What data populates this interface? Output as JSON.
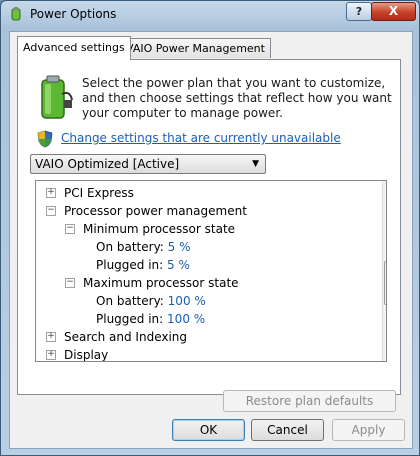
{
  "window": {
    "title": "Power Options"
  },
  "titlebar": {
    "help_label": "?",
    "close_label": "X"
  },
  "tabs": [
    {
      "label": "Advanced settings",
      "active": true
    },
    {
      "label": "VAIO Power Management",
      "active": false
    }
  ],
  "intro": {
    "text": "Select the power plan that you want to customize, and then choose settings that reflect how you want your computer to manage power.",
    "link": "Change settings that are currently unavailable"
  },
  "plan_select": {
    "value": "VAIO Optimized [Active]"
  },
  "tree": {
    "rows": [
      {
        "label": "PCI Express",
        "value": "",
        "expander": "+"
      },
      {
        "label": "Processor power management",
        "value": "",
        "expander": "−"
      },
      {
        "label": "Minimum processor state",
        "value": "",
        "expander": "−"
      },
      {
        "label": "On battery:",
        "value": "5 %",
        "expander": ""
      },
      {
        "label": "Plugged in:",
        "value": "5 %",
        "expander": ""
      },
      {
        "label": "Maximum processor state",
        "value": "",
        "expander": "−"
      },
      {
        "label": "On battery:",
        "value": "100 %",
        "expander": ""
      },
      {
        "label": "Plugged in:",
        "value": "100 %",
        "expander": ""
      },
      {
        "label": "Search and Indexing",
        "value": "",
        "expander": "+"
      },
      {
        "label": "Display",
        "value": "",
        "expander": "+"
      }
    ]
  },
  "buttons": {
    "restore": "Restore plan defaults",
    "ok": "OK",
    "cancel": "Cancel",
    "apply": "Apply"
  },
  "colors": {
    "link": "#1c5fb1",
    "close": "#c6412a"
  }
}
